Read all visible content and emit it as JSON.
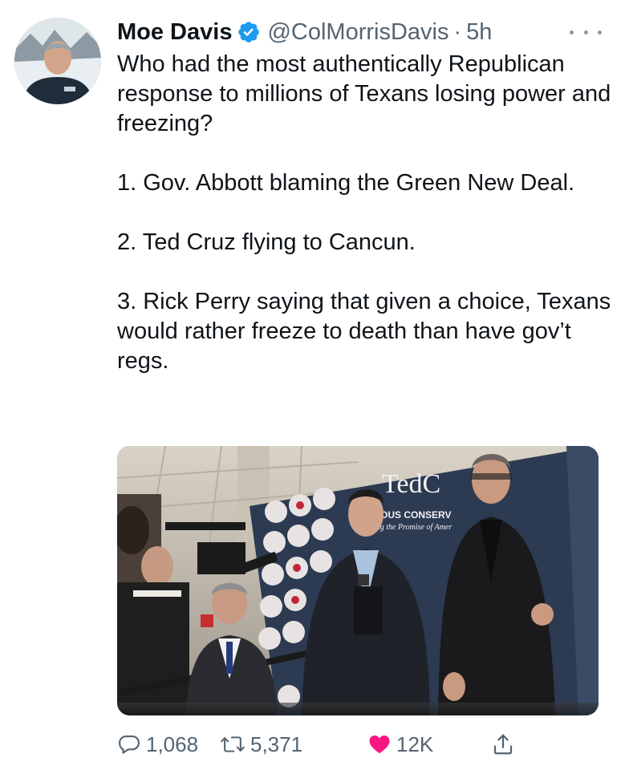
{
  "author": {
    "name": "Moe Davis",
    "handle": "@ColMorrisDavis",
    "separator": "·",
    "time": "5h"
  },
  "tweet": {
    "paragraphs": [
      "Who had the most authentically Republican response to millions of Texans losing power and freezing?",
      "1. Gov. Abbott blaming the Green New Deal.",
      "2. Ted Cruz flying to Cancun.",
      "3. Rick Perry saying that given a choice, Texans would rather freeze to death than have gov’t regs."
    ]
  },
  "media": {
    "backdrop_brand": "TedC",
    "backdrop_tagline": "EOUS CONSERV",
    "backdrop_subline": "ing the Promise of Amer"
  },
  "actions": {
    "reply_count": "1,068",
    "retweet_count": "5,371",
    "like_count": "12K"
  },
  "icons": {
    "verified": "verified-badge-icon",
    "more": "more-icon",
    "reply": "reply-icon",
    "retweet": "retweet-icon",
    "like": "heart-icon",
    "share": "share-icon"
  },
  "colors": {
    "verified": "#1d9bf0",
    "like": "#f91880",
    "muted": "#536471",
    "text": "#0f1419"
  }
}
